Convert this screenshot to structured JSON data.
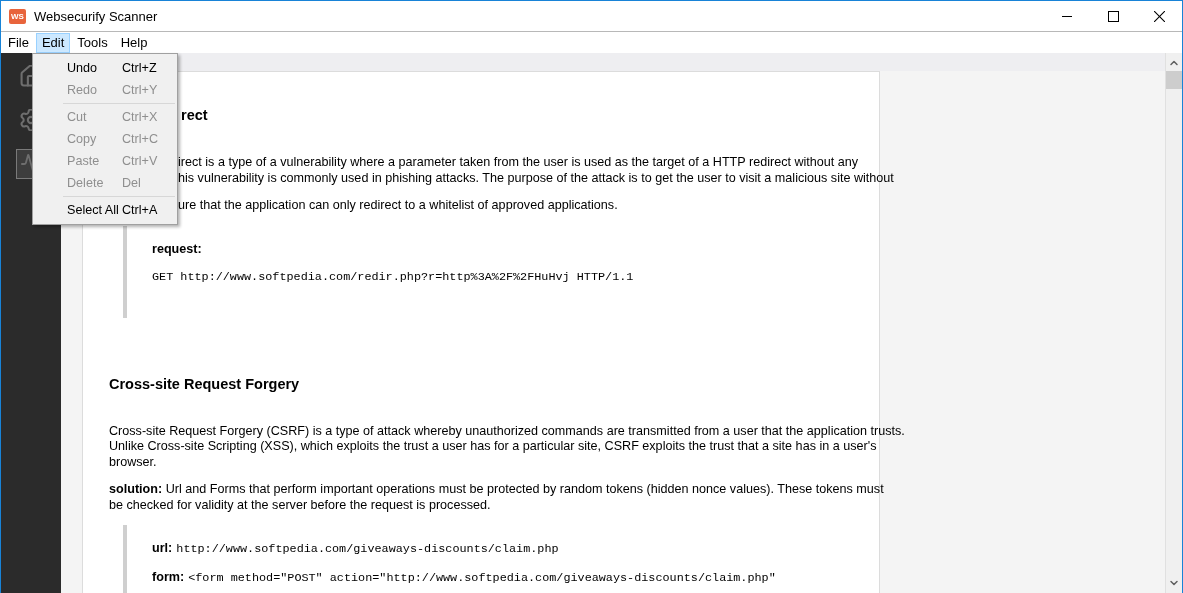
{
  "window": {
    "title": "Websecurify Scanner",
    "app_icon_text": "WS"
  },
  "menu_bar": [
    {
      "label": "File",
      "selected": false
    },
    {
      "label": "Edit",
      "selected": true
    },
    {
      "label": "Tools",
      "selected": false
    },
    {
      "label": "Help",
      "selected": false
    }
  ],
  "edit_menu": [
    {
      "kind": "item",
      "label": "Undo",
      "shortcut": "Ctrl+Z",
      "disabled": false
    },
    {
      "kind": "item",
      "label": "Redo",
      "shortcut": "Ctrl+Y",
      "disabled": true
    },
    {
      "kind": "separator"
    },
    {
      "kind": "item",
      "label": "Cut",
      "shortcut": "Ctrl+X",
      "disabled": true
    },
    {
      "kind": "item",
      "label": "Copy",
      "shortcut": "Ctrl+C",
      "disabled": true
    },
    {
      "kind": "item",
      "label": "Paste",
      "shortcut": "Ctrl+V",
      "disabled": true
    },
    {
      "kind": "item",
      "label": "Delete",
      "shortcut": "Del",
      "disabled": true
    },
    {
      "kind": "separator"
    },
    {
      "kind": "item",
      "label": "Select All",
      "shortcut": "Ctrl+A",
      "disabled": false
    }
  ],
  "sidebar": [
    {
      "kind": "home",
      "selected": false
    },
    {
      "kind": "settings",
      "selected": false
    },
    {
      "kind": "activity",
      "selected": true
    }
  ],
  "report": [
    {
      "partly_covered": true,
      "heading": "rect",
      "paragraphs": [
        {
          "lines": [
            "irect is a type of a vulnerability where a parameter taken from the user is used as the target of a HTTP redirect without any",
            "his vulnerability is commonly used in phishing attacks. The purpose of the attack is to get the user to visit a malicious site without"
          ]
        },
        {
          "lines": [
            "ure that the application can only redirect to a whitelist of approved applications."
          ]
        }
      ],
      "details": [
        {
          "kind": "stacked",
          "label": "request:",
          "code": "GET http://www.softpedia.com/redir.php?r=http%3A%2F%2FHuHvj HTTP/1.1"
        }
      ]
    },
    {
      "partly_covered": false,
      "heading": "Cross-site Request Forgery",
      "paragraphs": [
        {
          "lines": [
            "Cross-site Request Forgery (CSRF) is a type of attack whereby unauthorized commands are transmitted from a user that the application trusts.",
            "Unlike Cross-site Scripting (XSS), which exploits the trust a user has for a particular site, CSRF exploits the trust that a site has in a user's",
            "browser."
          ]
        },
        {
          "lines": [
            "**solution:** Url and Forms that perform important operations must be protected by random tokens (hidden nonce values). These tokens must",
            "be checked for validity at the server before the request is processed."
          ]
        }
      ],
      "details": [
        {
          "kind": "inline",
          "label": "url:",
          "code": "http://www.softpedia.com/giveaways-discounts/claim.php"
        },
        {
          "kind": "inline",
          "label": "form:",
          "code": "<form method=\"POST\" action=\"http://www.softpedia.com/giveaways-discounts/claim.php\""
        }
      ]
    }
  ]
}
